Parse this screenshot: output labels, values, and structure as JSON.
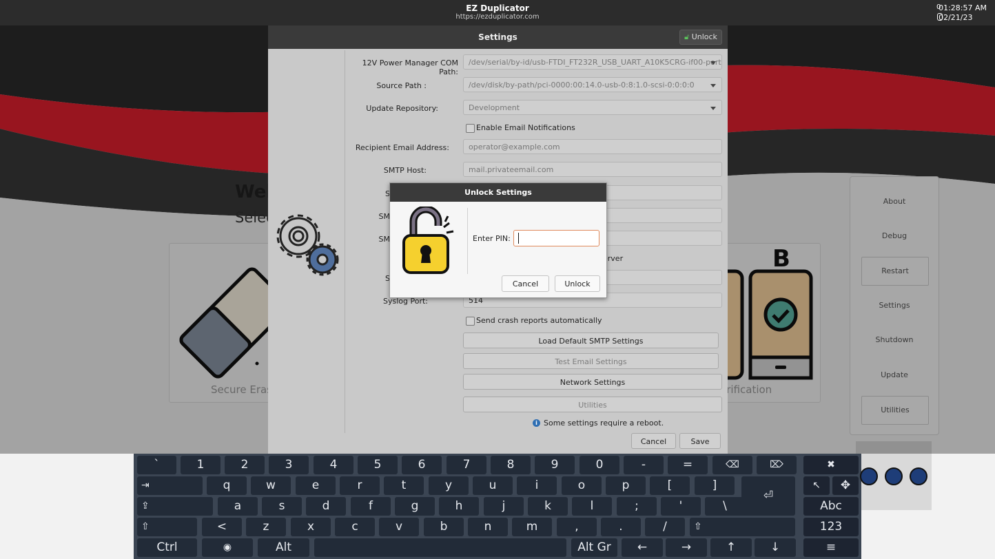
{
  "topbar": {
    "app_title": "EZ Duplicator",
    "app_url": "https://ezduplicator.com",
    "time": "01:28:57 AM",
    "date": "02/21/23",
    "sys_indicator": "0"
  },
  "background": {
    "welcome": "Wel",
    "select": "Selec",
    "card_left_label": "Secure Eras",
    "card_right_label": "erification",
    "card_right_letter": "B",
    "side_menu": [
      "About",
      "Debug",
      "Restart",
      "Settings",
      "Shutdown",
      "Update",
      "Utilities"
    ]
  },
  "settings": {
    "title": "Settings",
    "unlock_label": "Unlock",
    "fields": {
      "power_manager_label": "12V Power Manager COM Path:",
      "power_manager_value": "/dev/serial/by-id/usb-FTDI_FT232R_USB_UART_A10K5CRG-if00-port0",
      "source_path_label": "Source Path :",
      "source_path_value": "/dev/disk/by-path/pci-0000:00:14.0-usb-0:8:1.0-scsi-0:0:0:0",
      "update_repo_label": "Update Repository:",
      "update_repo_value": "Development",
      "enable_email_label": "Enable Email Notifications",
      "recipient_label": "Recipient Email Address:",
      "recipient_placeholder": "operator@example.com",
      "smtp_host_label": "SMTP Host:",
      "smtp_host_placeholder": "mail.privateemail.com",
      "smtp_port_label_partial": "S",
      "smtp_user_label_partial": "SM",
      "smtp_pass_label_partial": "SM",
      "syslog_checkbox_partial": "erver",
      "syslog_server_label_partial": "S",
      "syslog_port_label": "Syslog Port:",
      "syslog_port_value": "514",
      "crash_reports_label": "Send crash reports automatically"
    },
    "buttons": {
      "load_default_smtp": "Load Default SMTP Settings",
      "test_email": "Test Email Settings",
      "network_settings": "Network Settings",
      "utilities": "Utilities",
      "cancel": "Cancel",
      "save": "Save"
    },
    "reboot_note": "Some settings require a reboot.",
    "info_glyph": "i"
  },
  "unlock_dialog": {
    "title": "Unlock Settings",
    "pin_label": "Enter PIN:",
    "pin_value": "",
    "cancel": "Cancel",
    "unlock": "Unlock"
  },
  "keyboard": {
    "row1": [
      "`",
      "1",
      "2",
      "3",
      "4",
      "5",
      "6",
      "7",
      "8",
      "9",
      "0",
      "-",
      "=",
      "⌫",
      "⌦",
      "✖"
    ],
    "row2": [
      "⇥",
      "q",
      "w",
      "e",
      "r",
      "t",
      "y",
      "u",
      "i",
      "o",
      "p",
      "[",
      "]",
      "⏎",
      "↖",
      "✥"
    ],
    "row3": [
      "⇪",
      "a",
      "s",
      "d",
      "f",
      "g",
      "h",
      "j",
      "k",
      "l",
      ";",
      "'",
      "\\",
      "Abc"
    ],
    "row4": [
      "⇧",
      "<",
      "z",
      "x",
      "c",
      "v",
      "b",
      "n",
      "m",
      ",",
      ".",
      "/",
      "⇧",
      "123"
    ],
    "row5": [
      "Ctrl",
      "◉",
      "Alt",
      "",
      "Alt Gr",
      "←",
      "→",
      "↑",
      "↓",
      "≡"
    ]
  },
  "colors": {
    "brand_red": "#e3202f",
    "dark_band": "#2a2a2a",
    "keyboard_bg": "#3b4553",
    "key_bg": "#222b38",
    "dialog_header": "#3a3a3a",
    "pin_focus": "#e08a5c",
    "lock_yellow": "#f5d02e"
  }
}
